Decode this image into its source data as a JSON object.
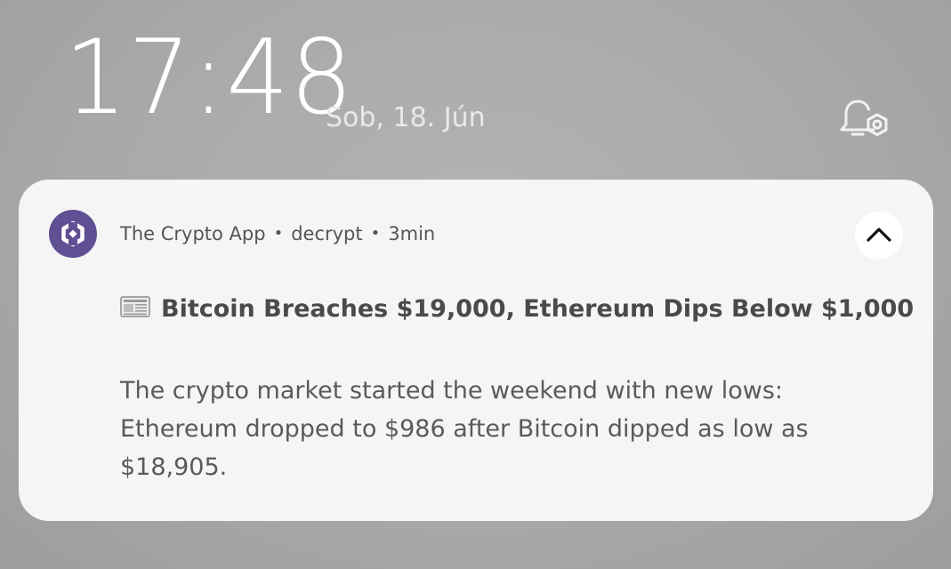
{
  "lockscreen": {
    "time": "17:48",
    "date": "Sob, 18. Jún",
    "bell_icon": "bell-settings-icon"
  },
  "notification": {
    "app_icon": "crypto-app-logo-icon",
    "app_name": "The Crypto App",
    "separator": "•",
    "source": "decrypt",
    "age": "3min",
    "collapse_icon": "chevron-up-icon",
    "title_icon": "newspaper-icon",
    "title": "Bitcoin Breaches $19,000, Ethereum Dips Below $1,000",
    "body": "The crypto market started the weekend with new lows: Ethereum dropped to $986 after Bitcoin dipped as low as $18,905."
  },
  "colors": {
    "app_icon_bg": "#5f4f93",
    "card_bg": "#f5f5f5"
  }
}
